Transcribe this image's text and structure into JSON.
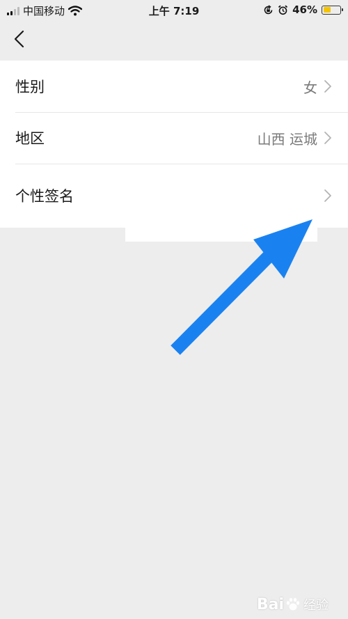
{
  "status_bar": {
    "carrier": "中国移动",
    "time": "上午 7:19",
    "battery_percent_text": "46%",
    "battery_level": 0.46
  },
  "nav": {
    "back_icon": "chevron-left-icon"
  },
  "list": {
    "items": [
      {
        "label": "性别",
        "value": "女"
      },
      {
        "label": "地区",
        "value": "山西 运城"
      },
      {
        "label": "个性签名",
        "value": ""
      }
    ]
  },
  "overlay": {
    "arrow_color": "#1a82f0"
  },
  "watermark": {
    "brand": "Bai",
    "suffix": "经验"
  },
  "colors": {
    "background": "#ededed",
    "card": "#ffffff",
    "battery_fill": "#f5c400"
  }
}
